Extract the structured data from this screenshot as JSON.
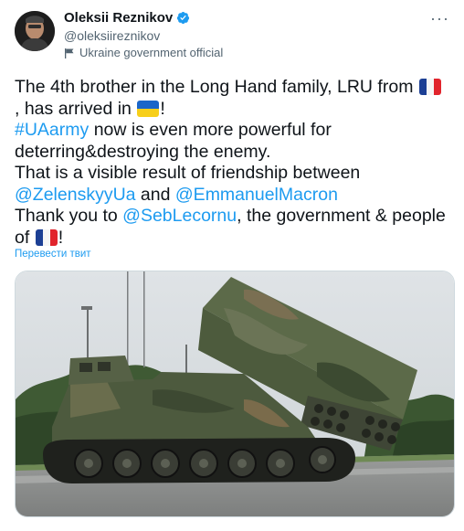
{
  "author": {
    "name": "Oleksii Reznikov",
    "handle": "@oleksiireznikov",
    "label": "Ukraine government official"
  },
  "tweet": {
    "l1": "The 4th brother in the Long Hand family, LRU from",
    "l2a": ", has arrived in",
    "l2b": "!",
    "hashtag": "#UAarmy",
    "l3b": " now is even more powerful for",
    "l4": "deterring&destroying the enemy.",
    "l5": "That is a visible result of friendship between",
    "mention1": "@ZelenskyyUa",
    "and": " and ",
    "mention2": "@EmmanuelMacron",
    "l7a": "Thank you to ",
    "mention3": "@SebLecornu",
    "l7b": ", the government & people",
    "l8a": "of",
    "l8b": "!"
  },
  "translate_label": "Перевести твит",
  "more_label": "···",
  "icons": {
    "verified": "verified-badge-icon",
    "government": "flag-icon",
    "more": "more-icon"
  },
  "colors": {
    "link": "#1d9bf0",
    "verified": "#1d9bf0",
    "text": "#0f1419",
    "secondary": "#536471"
  }
}
